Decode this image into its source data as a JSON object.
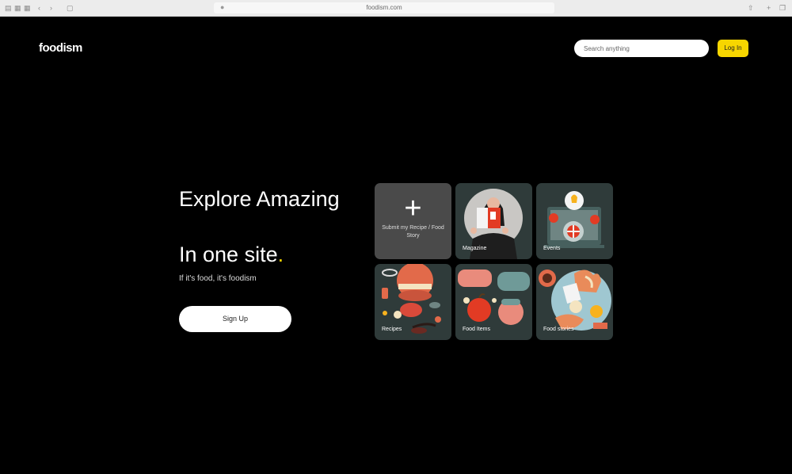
{
  "browser": {
    "url": "foodism.com",
    "icons": [
      "sidebar-icon",
      "back-icon",
      "forward-icon",
      "share-icon",
      "new-tab-icon",
      "tabs-icon"
    ]
  },
  "header": {
    "logo": "foodism",
    "search_placeholder": "Search anything",
    "login_label": "Log In"
  },
  "hero": {
    "headline_1": "Explore Amazing",
    "headline_2": "In one site",
    "headline_dot": ".",
    "tagline": "If it's food, it's foodism",
    "signup_label": "Sign Up"
  },
  "tiles": [
    {
      "label": "Submit my Recipe / Food Story",
      "icon": "plus-icon"
    },
    {
      "label": "Magazine"
    },
    {
      "label": "Events"
    },
    {
      "label": "Recipes"
    },
    {
      "label": "Food Items"
    },
    {
      "label": "Food stories"
    }
  ],
  "colors": {
    "background": "#000000",
    "accent": "#f7d600",
    "tile_bg": "#2f3b3a"
  }
}
